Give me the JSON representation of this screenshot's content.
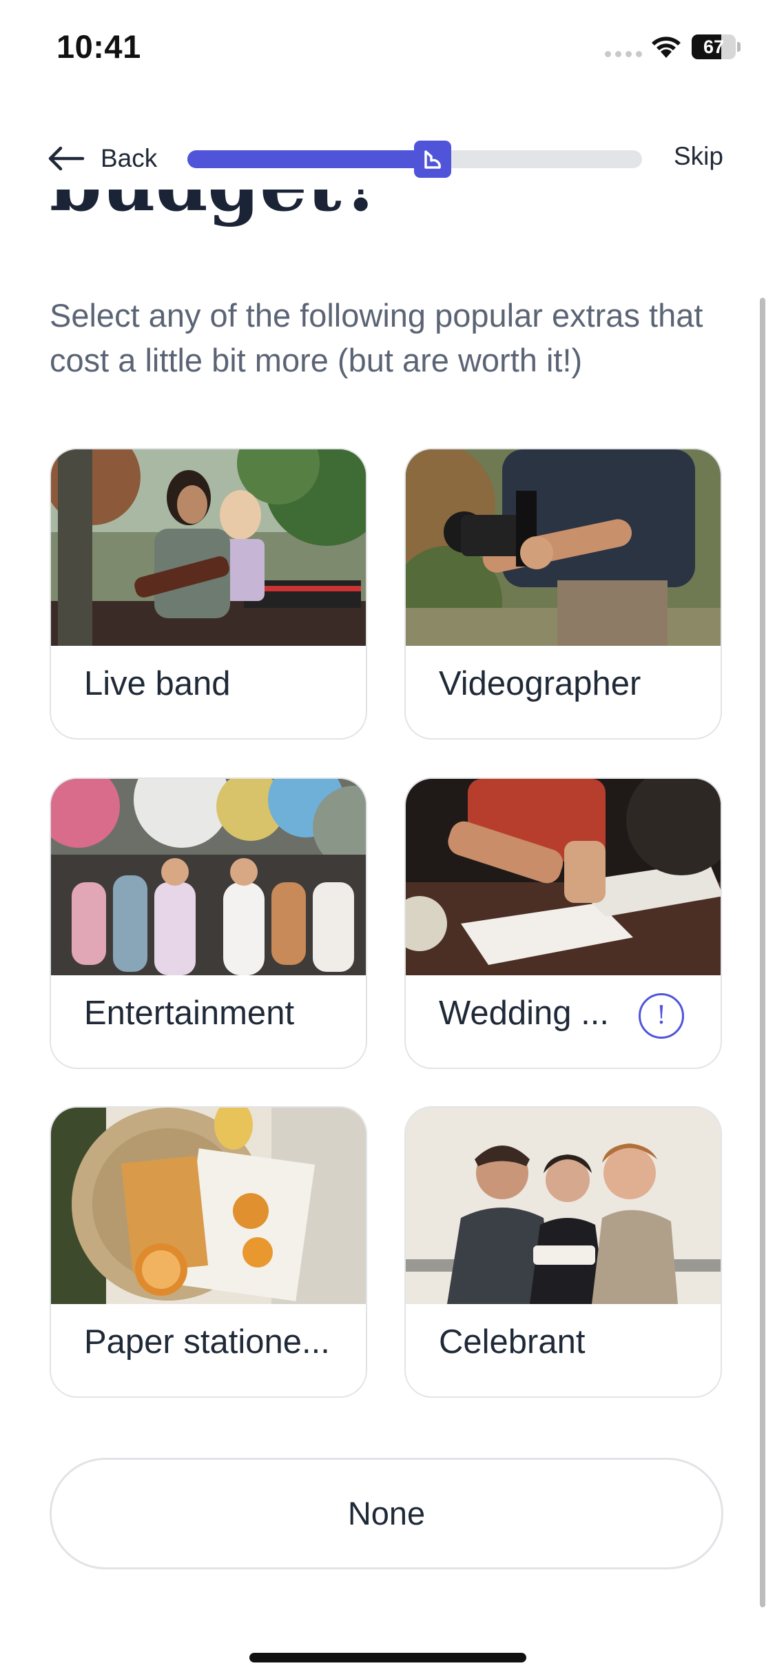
{
  "status_bar": {
    "time": "10:41",
    "battery": "67",
    "battery_level": 0.67
  },
  "nav": {
    "back_label": "Back",
    "skip_label": "Skip",
    "progress": 0.54
  },
  "content": {
    "heading": "budget?",
    "subtitle": "Select any of the following popular extras that cost a little bit more (but are worth it!)"
  },
  "options": [
    {
      "label": "Live band",
      "image_icon": "live-band-photo"
    },
    {
      "label": "Videographer",
      "image_icon": "videographer-photo"
    },
    {
      "label": "Entertainment",
      "image_icon": "entertainment-photo"
    },
    {
      "label": "Wedding ...",
      "image_icon": "wedding-photo",
      "info_symbol": "!"
    },
    {
      "label": "Paper statione...",
      "image_icon": "paper-stationery-photo"
    },
    {
      "label": "Celebrant",
      "image_icon": "celebrant-photo"
    }
  ],
  "none_button": {
    "label": "None"
  },
  "colors": {
    "accent": "#4f54d9",
    "text": "#1f2937",
    "subtitle": "#5b6475",
    "border": "#e2e3e7"
  }
}
